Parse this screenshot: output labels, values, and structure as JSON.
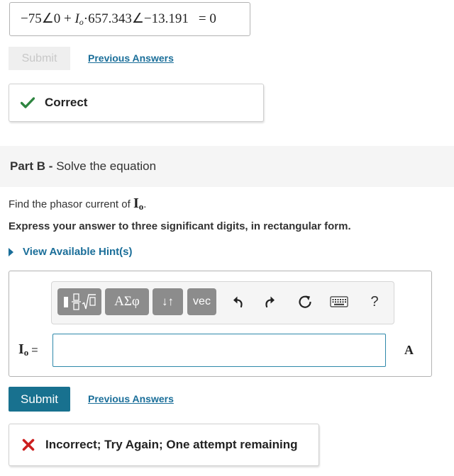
{
  "part_a": {
    "equation": {
      "term1": "−75∠0 + ",
      "var": "I",
      "var_sub": "o",
      "term2": "·657.343∠−13.191",
      "equals": "= 0"
    },
    "submit_label": "Submit",
    "previous_answers_label": "Previous Answers",
    "feedback_label": "Correct"
  },
  "part_b": {
    "title_prefix": "Part B - ",
    "title": "Solve the equation",
    "question_text": "Find the phasor current of ",
    "question_var": "I",
    "question_var_sub": "o",
    "question_end": ".",
    "instruction": "Express your answer to three significant digits, in rectangular form.",
    "hint_label": "View Available Hint(s)",
    "toolbar": {
      "templates_icon": "sqrt-template-icon",
      "greek_label": "ΑΣφ",
      "arrows_label": "↓↑",
      "vec_label": "vec",
      "undo_icon": "undo-icon",
      "redo_icon": "redo-icon",
      "reset_icon": "reset-icon",
      "keyboard_icon": "keyboard-icon",
      "help_label": "?"
    },
    "input_var": "I",
    "input_var_sub": "o",
    "input_equals": "=",
    "answer_value": "",
    "unit": "A",
    "submit_label": "Submit",
    "previous_answers_label": "Previous Answers",
    "feedback_label": "Incorrect; Try Again; One attempt remaining"
  },
  "colors": {
    "accent": "#18718f",
    "link": "#1a6e99",
    "correct": "#2e8540",
    "incorrect": "#cc1f1f"
  }
}
